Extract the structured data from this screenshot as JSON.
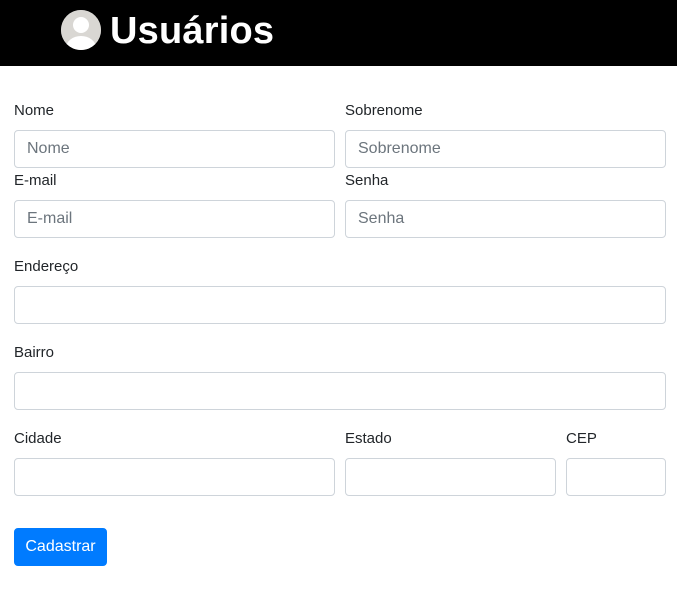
{
  "header": {
    "title": "Usuários",
    "avatar_icon": "user-avatar-icon",
    "background": "#000000"
  },
  "form": {
    "nome": {
      "label": "Nome",
      "placeholder": "Nome",
      "value": ""
    },
    "sobrenome": {
      "label": "Sobrenome",
      "placeholder": "Sobrenome",
      "value": ""
    },
    "email": {
      "label": "E-mail",
      "placeholder": "E-mail",
      "value": ""
    },
    "senha": {
      "label": "Senha",
      "placeholder": "Senha",
      "value": ""
    },
    "endereco": {
      "label": "Endereço",
      "value": ""
    },
    "bairro": {
      "label": "Bairro",
      "value": ""
    },
    "cidade": {
      "label": "Cidade",
      "value": ""
    },
    "estado": {
      "label": "Estado",
      "value": ""
    },
    "cep": {
      "label": "CEP",
      "value": ""
    },
    "submit_label": "Cadastrar"
  },
  "colors": {
    "primary": "#007bff",
    "input_border": "#ced4da",
    "placeholder": "#6c757d"
  }
}
